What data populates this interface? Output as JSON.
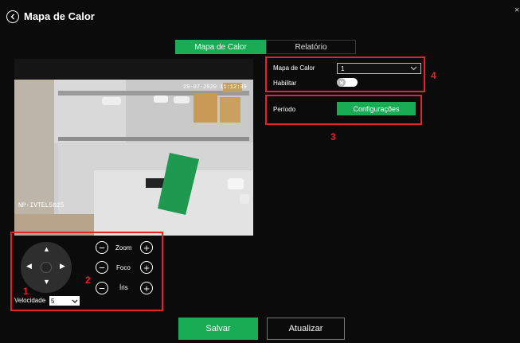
{
  "header": {
    "title": "Mapa de Calor",
    "back_icon": "chevron-left-icon",
    "close_glyph": "×"
  },
  "tabs": [
    {
      "label": "Mapa de Calor",
      "active": true
    },
    {
      "label": "Relatório",
      "active": false
    }
  ],
  "video": {
    "overlay_text": "NP-IVTEL5025",
    "timestamp": "20-07-2020 11:12:39"
  },
  "ptz": {
    "zoom_label": "Zoom",
    "focus_label": "Foco",
    "iris_label": "Íris",
    "speed_label": "Velocidade",
    "speed_value": "5",
    "up_glyph": "▲",
    "down_glyph": "▼",
    "left_glyph": "◀",
    "right_glyph": "▶",
    "minus_glyph": "−",
    "plus_glyph": "+"
  },
  "settings": {
    "heatmap_label": "Mapa de Calor",
    "heatmap_value": "1",
    "enable_label": "Habilitar",
    "enable_on": false,
    "period_label": "Período",
    "config_button": "Configurações"
  },
  "callouts": [
    "1",
    "2",
    "3",
    "4"
  ],
  "footer": {
    "save_label": "Salvar",
    "refresh_label": "Atualizar"
  },
  "colors": {
    "accent": "#1aab55",
    "callout_red": "#e8222c",
    "background": "#0b0b0b"
  }
}
